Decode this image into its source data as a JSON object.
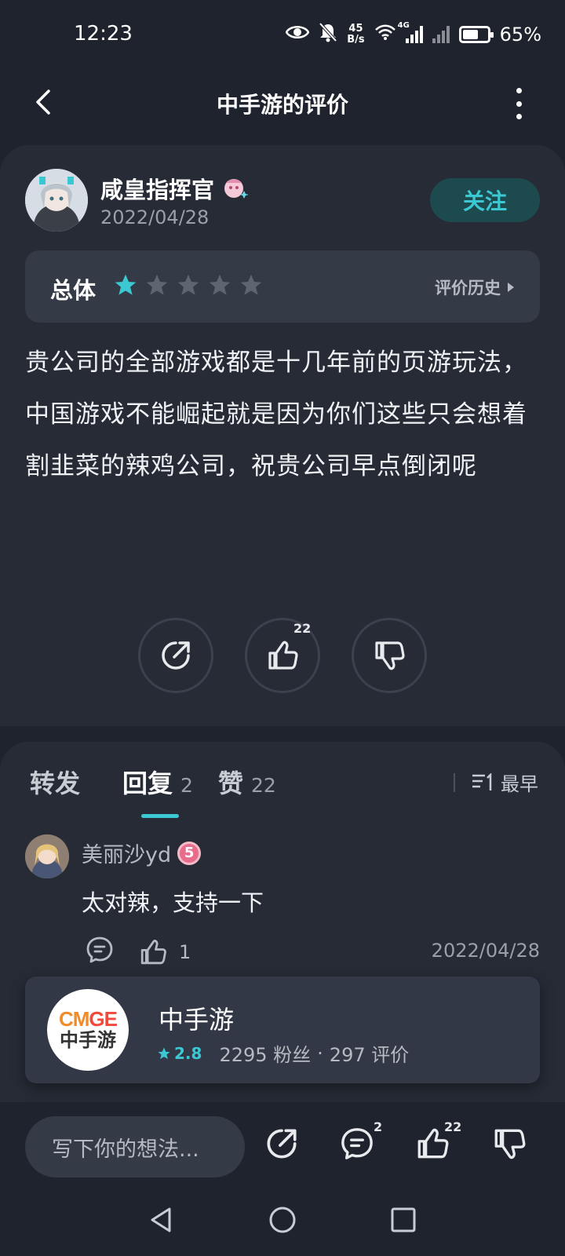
{
  "status_bar": {
    "time": "12:23",
    "net_speed_value": "45",
    "net_speed_unit": "B/s",
    "signal_tag": "4G",
    "battery_percent": "65%",
    "battery_level": 0.65
  },
  "header": {
    "title": "中手游的评价"
  },
  "review": {
    "author": "咸皇指挥官",
    "date": "2022/04/28",
    "follow_label": "关注",
    "rating_label": "总体",
    "rating_value": 1,
    "rating_max": 5,
    "history_label": "评价历史",
    "text": "贵公司的全部游戏都是十几年前的页游玩法，中国游戏不能崛起就是因为你们这些只会想着割韭菜的辣鸡公司，祝贵公司早点倒闭呢",
    "like_count": "22"
  },
  "tabs": {
    "items": [
      {
        "label": "转发",
        "count": ""
      },
      {
        "label": "回复",
        "count": "2"
      },
      {
        "label": "赞",
        "count": "22"
      }
    ],
    "active": 1,
    "sort_label": "最早"
  },
  "comments": [
    {
      "name": "美丽沙yd",
      "level": "5",
      "text": "太对辣，支持一下",
      "likes": "1",
      "date": "2022/04/28"
    }
  ],
  "game_card": {
    "logo_top": "CMGE",
    "logo_bottom": "中手游",
    "name": "中手游",
    "rating": "2.8",
    "followers": "2295 粉丝",
    "separator": "·",
    "reviews": "297 评价"
  },
  "bottom_bar": {
    "input_placeholder": "写下你的想法...",
    "reply_count": "2",
    "like_count": "22"
  },
  "colors": {
    "accent": "#3cc8d2",
    "background": "#1f232d",
    "card": "#262b35"
  }
}
